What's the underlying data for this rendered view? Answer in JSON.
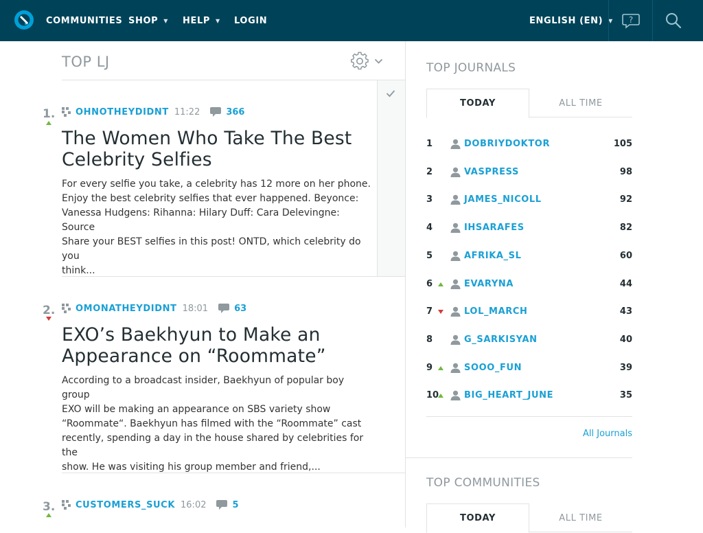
{
  "nav": {
    "communities": "COMMUNITIES",
    "shop": "SHOP",
    "help": "HELP",
    "login": "LOGIN",
    "language": "ENGLISH (EN)"
  },
  "page_title": "TOP LJ",
  "posts": [
    {
      "rank": "1.",
      "trend": "up",
      "user": "OHNOTHEYDIDNT",
      "time": "11:22",
      "comments": "366",
      "headline_1": "The Women Who Take The Best",
      "headline_2": "Celebrity Selfies",
      "body": [
        "For every selfie you take, a celebrity has 12 more on her phone.",
        "Enjoy the best celebrity selfies that ever happened. Beyonce:",
        "Vanessa Hudgens: Rihanna: Hilary Duff: Cara Delevingne: Source",
        "Share your BEST selfies in this post! ONTD, which celebrity do you",
        "think..."
      ]
    },
    {
      "rank": "2.",
      "trend": "down",
      "user": "OMONATHEYDIDNT",
      "time": "18:01",
      "comments": "63",
      "headline_1": "EXO’s Baekhyun to Make an",
      "headline_2": "Appearance on “Roommate”",
      "body": [
        "According to a broadcast insider, Baekhyun of popular boy group",
        "EXO will be making an appearance on SBS variety show",
        "“Roommate“. Baekhyun has filmed with the “Roommate” cast",
        "recently, spending a day in the house shared by celebrities for the",
        "show. He was visiting his group member and friend,..."
      ]
    },
    {
      "rank": "3.",
      "trend": "up",
      "user": "CUSTOMERS_SUCK",
      "time": "16:02",
      "comments": "5"
    }
  ],
  "sidebar": {
    "journals_title": "TOP JOURNALS",
    "tab_today": "TODAY",
    "tab_all_time": "ALL TIME",
    "journals": [
      {
        "num": "1",
        "trend": "",
        "name": "DOBRIYDOKTOR",
        "score": "105"
      },
      {
        "num": "2",
        "trend": "",
        "name": "VASPRESS",
        "score": "98"
      },
      {
        "num": "3",
        "trend": "",
        "name": "JAMES_NICOLL",
        "score": "92"
      },
      {
        "num": "4",
        "trend": "",
        "name": "IHSARAFES",
        "score": "82"
      },
      {
        "num": "5",
        "trend": "",
        "name": "AFRIKA_SL",
        "score": "60"
      },
      {
        "num": "6",
        "trend": "up",
        "name": "EVARYNA",
        "score": "44"
      },
      {
        "num": "7",
        "trend": "down",
        "name": "LOL_MARCH",
        "score": "43"
      },
      {
        "num": "8",
        "trend": "",
        "name": "G_SARKISYAN",
        "score": "40"
      },
      {
        "num": "9",
        "trend": "up",
        "name": "SOOO_FUN",
        "score": "39"
      },
      {
        "num": "10",
        "trend": "up",
        "name": "BIG_HEART_JUNE",
        "score": "35"
      }
    ],
    "all_journals": "All Journals",
    "communities_title": "TOP COMMUNITIES"
  },
  "colors": {
    "header_bg": "#004359",
    "link_blue": "#1aa0d5",
    "trend_up": "#72b83e",
    "trend_down": "#d43b3b"
  }
}
